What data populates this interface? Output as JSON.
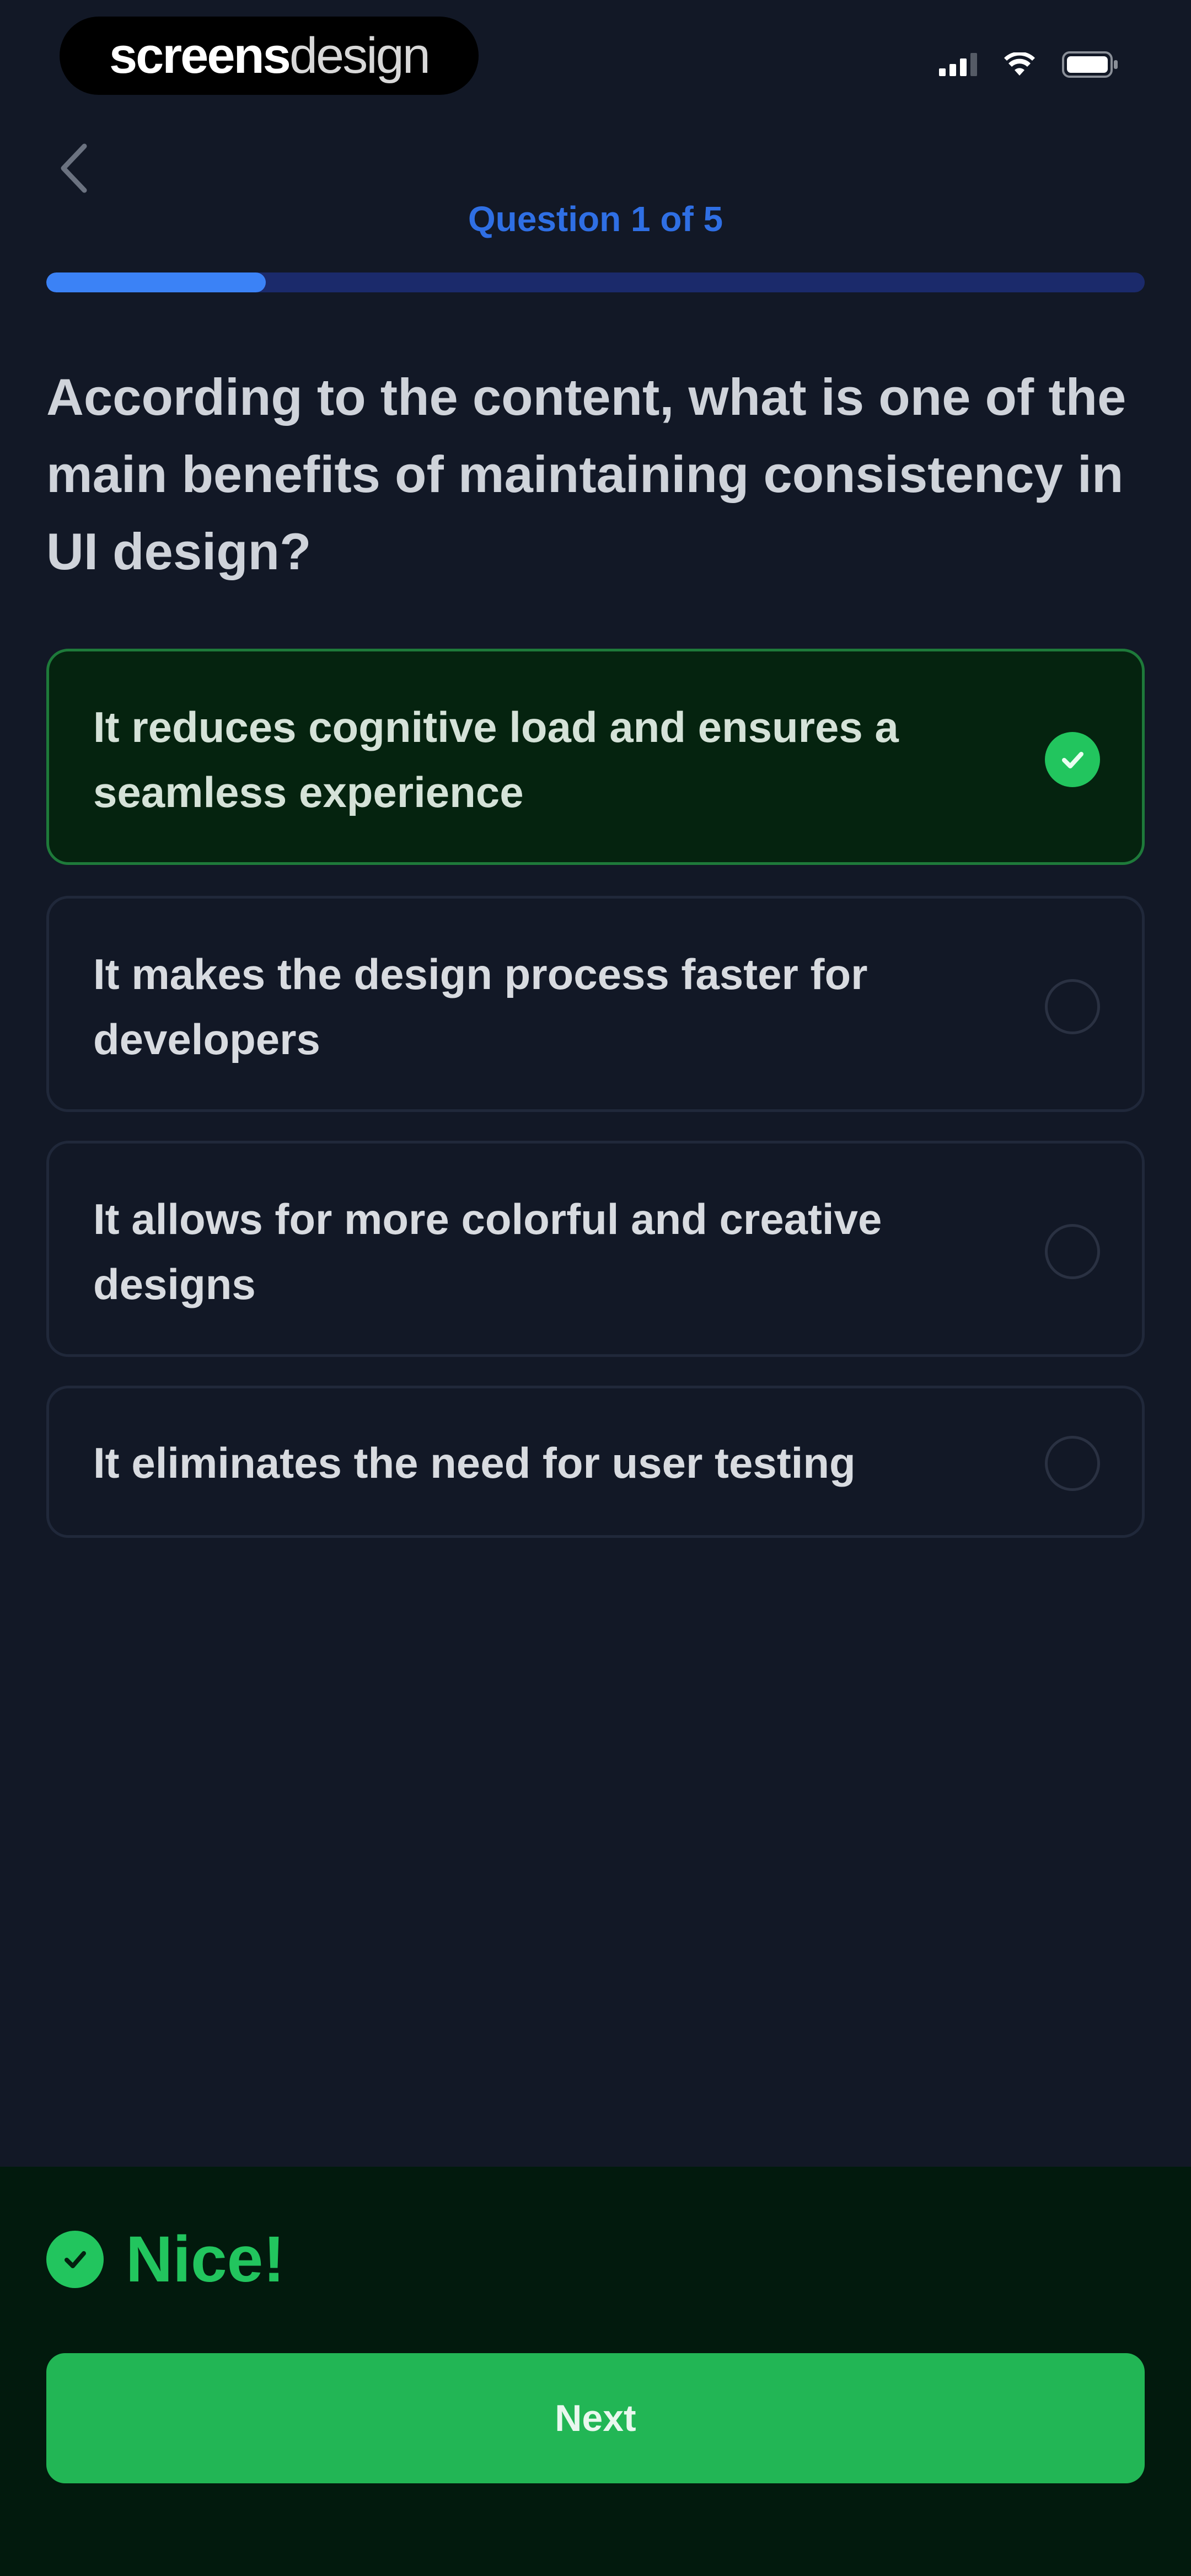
{
  "status_bar": {
    "brand_bold": "screens",
    "brand_light": "design",
    "signal_icon": "cellular-signal-icon",
    "wifi_icon": "wifi-icon",
    "battery_icon": "battery-icon"
  },
  "nav": {
    "back_icon": "chevron-left-icon"
  },
  "progress": {
    "label": "Question 1 of 5",
    "current": 1,
    "total": 5,
    "fraction": 0.2
  },
  "question": {
    "text": "According to the content, what is one of the main benefits of maintaining consistency in UI design?"
  },
  "options": [
    {
      "label": "It reduces cognitive load and ensures a seamless experience",
      "selected": true
    },
    {
      "label": "It makes the design process faster for developers",
      "selected": false
    },
    {
      "label": "It allows for more colorful and creative designs",
      "selected": false
    },
    {
      "label": "It eliminates the need for user testing",
      "selected": false
    }
  ],
  "feedback": {
    "icon": "check-circle-icon",
    "text": "Nice!"
  },
  "footer": {
    "next_label": "Next"
  },
  "colors": {
    "background": "#121826",
    "accent_blue": "#3b82f6",
    "success_green": "#22c55e",
    "selected_bg": "#05230f",
    "feedback_bg": "#021a0d"
  }
}
